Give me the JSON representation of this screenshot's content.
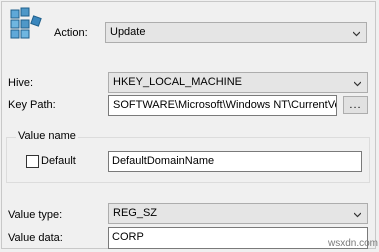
{
  "action": {
    "label": "Action:",
    "value": "Update"
  },
  "hive": {
    "label": "Hive:",
    "value": "HKEY_LOCAL_MACHINE"
  },
  "key_path": {
    "label": "Key Path:",
    "value": "SOFTWARE\\Microsoft\\Windows NT\\CurrentVer",
    "browse_label": "..."
  },
  "value_name": {
    "group_title": "Value name",
    "default_label": "Default",
    "default_checked": false,
    "name": "DefaultDomainName"
  },
  "value_type": {
    "label": "Value type:",
    "value": "REG_SZ"
  },
  "value_data": {
    "label": "Value data:",
    "value": "CORP"
  },
  "watermark": "wsxdn.com",
  "icon": "registry-cubes-icon"
}
